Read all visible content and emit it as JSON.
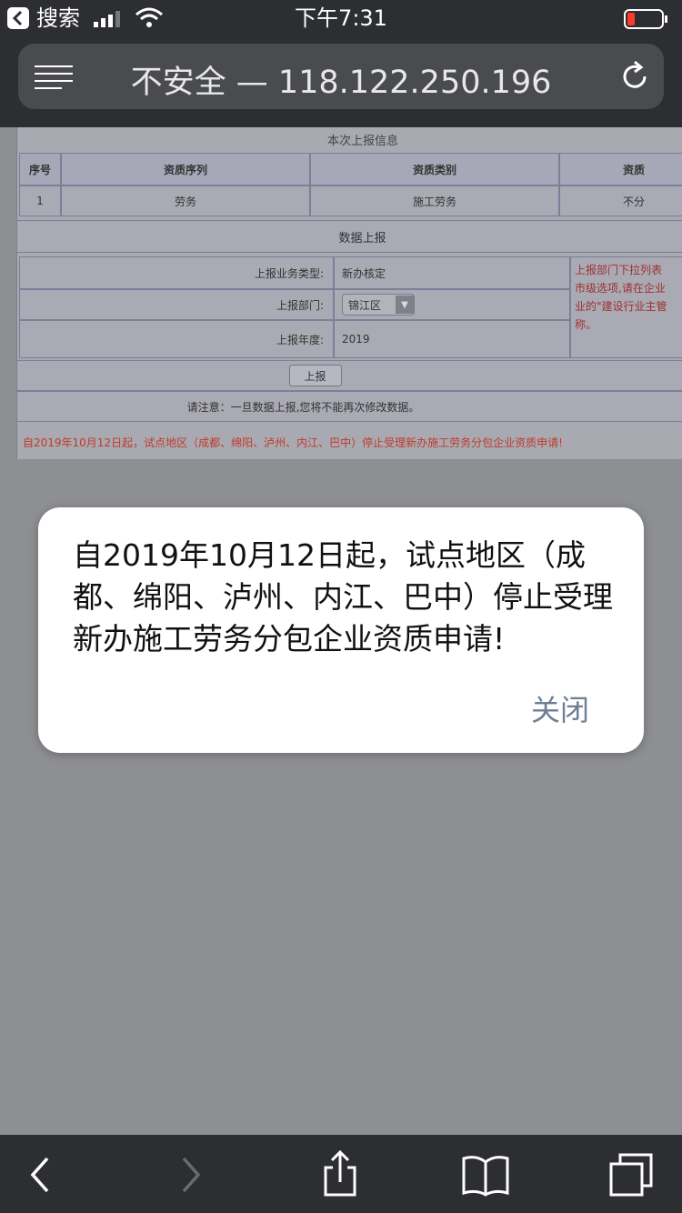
{
  "status_bar": {
    "back_app_label": "搜索",
    "time": "下午7:31"
  },
  "browser": {
    "address_text": "不安全 — 118.122.250.196"
  },
  "page": {
    "section_title": "本次上报信息",
    "table_headers": [
      "序号",
      "资质序列",
      "资质类别",
      "资质"
    ],
    "table_row": [
      "1",
      "劳务",
      "施工劳务",
      "不分"
    ],
    "data_section_title": "数据上报",
    "form": {
      "business_type_label": "上报业务类型:",
      "business_type_value": "新办核定",
      "department_label": "上报部门:",
      "department_value": "锦江区",
      "year_label": "上报年度:",
      "year_value": "2019"
    },
    "side_note": {
      "line1": "上报部门下拉列表",
      "line2": "市级选项,请在企业",
      "line3": "业的\"建设行业主管",
      "line4": "称。"
    },
    "submit_button": "上报",
    "warning": "请注意：一旦数据上报,您将不能再次修改数据。",
    "notice": "自2019年10月12日起，试点地区（成都、绵阳、泸州、内江、巴中）停止受理新办施工劳务分包企业资质申请!"
  },
  "dialog": {
    "message": "自2019年10月12日起，试点地区（成都、绵阳、泸州、内江、巴中）停止受理新办施工劳务分包企业资质申请!",
    "close_label": "关闭"
  },
  "colors": {
    "chrome": "#2d2e31",
    "notice_red": "#c0392b",
    "link_gray_blue": "#6c7f94"
  }
}
